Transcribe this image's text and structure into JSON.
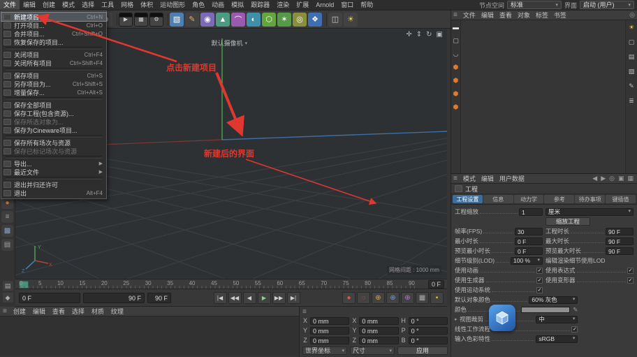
{
  "colors": {
    "accent_blue": "#3f6d99",
    "annotation_red": "#e0372e",
    "axis_x": "#a04438",
    "axis_y": "#4ea34e",
    "axis_z": "#4a7fc0"
  },
  "icons": {
    "hamburger": "≡",
    "caret": "▾",
    "search": "◎",
    "camera_caret": "▾",
    "eyedropper": "✎"
  },
  "menubar": {
    "items": [
      {
        "label": "文件",
        "active": true
      },
      {
        "label": "编辑"
      },
      {
        "label": "创建"
      },
      {
        "label": "模式"
      },
      {
        "label": "选择"
      },
      {
        "label": "工具"
      },
      {
        "label": "网格"
      },
      {
        "label": "体积"
      },
      {
        "label": "运动图形"
      },
      {
        "label": "角色"
      },
      {
        "label": "动画"
      },
      {
        "label": "模拟"
      },
      {
        "label": "跟踪器"
      },
      {
        "label": "渲染"
      },
      {
        "label": "扩展"
      },
      {
        "label": "Arnold"
      },
      {
        "label": "窗口"
      },
      {
        "label": "帮助"
      }
    ],
    "node_space_label": "节点空间",
    "node_space_value": "标准",
    "interface_label": "界面",
    "interface_value": "启动 (用户)"
  },
  "toolbar": {
    "icons": [
      {
        "name": "undo-icon",
        "glyph": "↶",
        "fg": "#e3bd66"
      },
      {
        "name": "redo-icon",
        "glyph": "↷",
        "fg": "#9f9f9f"
      },
      {
        "sep": true
      },
      {
        "name": "live-selection-icon",
        "glyph": "⇖",
        "fg": "#eeeeee"
      },
      {
        "sep": true
      },
      {
        "name": "lock-x-axis-icon",
        "glyph": "X",
        "circle": true
      },
      {
        "name": "lock-y-axis-icon",
        "glyph": "Y",
        "circle": true
      },
      {
        "name": "lock-z-axis-icon",
        "glyph": "Z",
        "circle": true
      },
      {
        "name": "coordinate-system-icon",
        "glyph": "⊕",
        "fg": "#cfcfcf"
      },
      {
        "sep": true
      },
      {
        "name": "render-view-icon",
        "glyph": "▶",
        "clap": true
      },
      {
        "name": "render-region-icon",
        "glyph": "▦",
        "clap": true
      },
      {
        "name": "render-settings-icon",
        "glyph": "⚙",
        "clap": true
      },
      {
        "sep": true
      },
      {
        "name": "cube-primitive-icon",
        "glyph": "▧",
        "fg": "#ffffff",
        "bg": "#4d7fb3"
      },
      {
        "name": "pen-spline-icon",
        "glyph": "✎",
        "fg": "#e8b25a"
      },
      {
        "name": "subdivision-surface-icon",
        "glyph": "◉",
        "fg": "#ffffff",
        "bg": "#7a6ab8"
      },
      {
        "name": "extrude-icon",
        "glyph": "▲",
        "fg": "#ffffff",
        "bg": "#4d9b82"
      },
      {
        "name": "bend-deformer-icon",
        "glyph": "⌒",
        "fg": "#ffffff",
        "bg": "#9a5ab0"
      },
      {
        "name": "field-icon",
        "glyph": "◐",
        "fg": "#ffffff",
        "bg": "#3f8fa8"
      },
      {
        "name": "cloner-icon",
        "glyph": "⬡",
        "fg": "#ffffff",
        "bg": "#63a53f"
      },
      {
        "name": "effector-icon",
        "glyph": "✶",
        "fg": "#ffffff",
        "bg": "#559a46"
      },
      {
        "name": "simulation-icon",
        "glyph": "◎",
        "fg": "#ffffff",
        "bg": "#8a8f3f"
      },
      {
        "name": "volume-icon",
        "glyph": "❖",
        "fg": "#ffffff",
        "bg": "#3f6fb0"
      },
      {
        "sep": true
      },
      {
        "name": "camera-icon",
        "glyph": "◫",
        "fg": "#cfcfcf"
      },
      {
        "name": "light-icon",
        "glyph": "☀",
        "fg": "#e8cf5a"
      }
    ]
  },
  "left_toolbar": {
    "icons": [
      {
        "name": "make-editable-icon",
        "glyph": "◇",
        "fg": "#cfcfcf"
      },
      {
        "name": "model-mode-icon",
        "glyph": "▣",
        "fg": "#cfcfcf"
      },
      {
        "name": "texture-mode-icon",
        "glyph": "▨",
        "fg": "#cfcfcf"
      },
      {
        "name": "workplane-mode-icon",
        "glyph": "▦",
        "fg": "#cfcfcf"
      },
      {
        "name": "point-mode-icon",
        "glyph": "∴",
        "fg": "#cfcfcf"
      },
      {
        "name": "edge-mode-icon",
        "glyph": "╱",
        "fg": "#cfcfcf"
      },
      {
        "name": "polygon-mode-icon",
        "glyph": "▲",
        "fg": "#cfcfcf"
      },
      {
        "name": "axis-mode-icon",
        "glyph": "✛",
        "fg": "#cfcfcf"
      },
      {
        "name": "solo-mode-icon",
        "glyph": "◎",
        "fg": "#cfcfcf"
      },
      {
        "name": "snap-icon",
        "glyph": "◈",
        "fg": "#cfcfcf"
      },
      {
        "gap": true
      },
      {
        "name": "content-browser-icon",
        "glyph": "●",
        "fg": "#e07a2e"
      },
      {
        "name": "script-icon",
        "glyph": "≡",
        "fg": "#9f9f9f"
      },
      {
        "name": "xpresso-icon",
        "glyph": "▩",
        "fg": "#7a9fd4"
      },
      {
        "name": "console-icon",
        "glyph": "▤",
        "fg": "#9f9f9f"
      }
    ]
  },
  "file_menu": {
    "items": [
      {
        "label": "新建项目",
        "shortcut": "Ctrl+N",
        "highlight": true
      },
      {
        "label": "打开项目...",
        "shortcut": "Ctrl+O"
      },
      {
        "label": "合并项目...",
        "shortcut": "Ctrl+Shift+O"
      },
      {
        "label": "恢复保存的项目..."
      },
      {
        "sep": true
      },
      {
        "label": "关闭项目",
        "shortcut": "Ctrl+F4"
      },
      {
        "label": "关闭所有项目",
        "shortcut": "Ctrl+Shift+F4"
      },
      {
        "sep": true
      },
      {
        "label": "保存项目",
        "shortcut": "Ctrl+S"
      },
      {
        "label": "另存项目为...",
        "shortcut": "Ctrl+Shift+S"
      },
      {
        "label": "增量保存...",
        "shortcut": "Ctrl+Alt+S"
      },
      {
        "sep": true
      },
      {
        "label": "保存全部项目"
      },
      {
        "label": "保存工程(包含资源)..."
      },
      {
        "label": "保存所选对象为...",
        "disabled": true
      },
      {
        "label": "保存为Cineware项目..."
      },
      {
        "sep": true
      },
      {
        "label": "保存所有场次与资源"
      },
      {
        "label": "保存已标记场次与资源",
        "disabled": true
      },
      {
        "sep": true
      },
      {
        "label": "导出...",
        "arrow": "▶"
      },
      {
        "label": "最近文件",
        "arrow": "▶"
      },
      {
        "sep": true
      },
      {
        "label": "退出并归还许可"
      },
      {
        "label": "退出",
        "shortcut": "Alt+F4"
      }
    ]
  },
  "viewport": {
    "camera_label": "默认摄像机",
    "grid_label": "网格间距 : 1000 mm",
    "axis_labels": {
      "x": "X",
      "y": "Y",
      "z": "Z"
    },
    "nav_icons": [
      {
        "name": "pan-view-icon",
        "glyph": "✛"
      },
      {
        "name": "zoom-view-icon",
        "glyph": "⇕"
      },
      {
        "name": "rotate-view-icon",
        "glyph": "↻"
      },
      {
        "name": "maximize-view-icon",
        "glyph": "▣"
      }
    ]
  },
  "annotations": {
    "click_text": "点击新建项目",
    "result_text": "新建后的界面"
  },
  "timeline": {
    "numbers": [
      "0",
      "5",
      "10",
      "15",
      "20",
      "25",
      "30",
      "35",
      "40",
      "45",
      "50",
      "55",
      "60",
      "65",
      "70",
      "75",
      "80",
      "85",
      "90"
    ],
    "end_label": "0 F"
  },
  "transport": {
    "current": "0 F",
    "range_end": "90 F",
    "range_end2": "90 F",
    "playback": [
      {
        "name": "goto-start-button",
        "glyph": "|◀"
      },
      {
        "name": "prev-key-button",
        "glyph": "◀◀"
      },
      {
        "name": "prev-frame-button",
        "glyph": "◀"
      },
      {
        "name": "play-button",
        "glyph": "▶",
        "play": true
      },
      {
        "name": "next-frame-button",
        "glyph": "▶▶"
      },
      {
        "name": "goto-end-button",
        "glyph": "▶|"
      }
    ],
    "record": [
      {
        "name": "record-keyframe-button",
        "glyph": "●",
        "fg": "#d8584a"
      },
      {
        "name": "autokey-button",
        "glyph": "◌",
        "fg": "#d8584a"
      },
      {
        "name": "record-position-button",
        "glyph": "⊕",
        "fg": "#e0a23c"
      },
      {
        "name": "record-scale-button",
        "glyph": "⊕",
        "fg": "#6b9bd2"
      },
      {
        "name": "record-rotation-button",
        "glyph": "⊕",
        "fg": "#b671d6"
      },
      {
        "name": "record-parameter-button",
        "glyph": "▦",
        "fg": "#a8a8a8"
      },
      {
        "name": "record-pla-button",
        "glyph": "▪",
        "fg": "#d9c24a"
      }
    ],
    "corner_icons": [
      {
        "name": "timeline-layout-icon",
        "glyph": "▤"
      },
      {
        "name": "keyframe-icon",
        "glyph": "◆"
      }
    ]
  },
  "material_panel": {
    "menus": [
      "创建",
      "编辑",
      "查看",
      "选择",
      "材质",
      "纹理"
    ]
  },
  "coord_panel": {
    "rows": [
      {
        "l1": "X",
        "v1": "0 mm",
        "l2": "X",
        "v2": "0 mm",
        "l3": "H",
        "v3": "0 °"
      },
      {
        "l1": "Y",
        "v1": "0 mm",
        "l2": "Y",
        "v2": "0 mm",
        "l3": "P",
        "v3": "0 °"
      },
      {
        "l1": "Z",
        "v1": "0 mm",
        "l2": "Z",
        "v2": "0 mm",
        "l3": "B",
        "v3": "0 °"
      }
    ],
    "mode_select": "世界坐标",
    "size_select": "尺寸",
    "apply_label": "应用"
  },
  "object_manager": {
    "menus": [
      "文件",
      "编辑",
      "查看",
      "对象",
      "标签",
      "书签"
    ],
    "left_strip": [
      {
        "name": "clapper-icon",
        "glyph": "▬",
        "fg": "#e8e8e8"
      },
      {
        "name": "screen-icon",
        "glyph": "▢",
        "fg": "#bdbdbd"
      },
      {
        "name": "magnet-icon",
        "glyph": "◡",
        "fg": "#bdbdbd"
      },
      {
        "name": "hex-bolt-icon-1",
        "glyph": "⬢",
        "fg": "#e07a2e"
      },
      {
        "name": "hex-bolt-icon-2",
        "glyph": "⬢",
        "fg": "#e07a2e"
      },
      {
        "name": "hex-bolt-icon-3",
        "glyph": "⬢",
        "fg": "#e07a2e"
      },
      {
        "name": "hex-bolt-icon-4",
        "glyph": "⬢",
        "fg": "#e07a2e"
      }
    ],
    "right_strip": [
      {
        "name": "light-bulb-icon",
        "glyph": "☀",
        "fg": "#e8cf5a"
      },
      {
        "name": "monitor-icon",
        "glyph": "▢",
        "fg": "#bdbdbd"
      },
      {
        "name": "film-icon",
        "glyph": "▤",
        "fg": "#bdbdbd"
      },
      {
        "name": "cube-icon",
        "glyph": "▧",
        "fg": "#bdbdbd"
      },
      {
        "name": "pen-icon",
        "glyph": "✎",
        "fg": "#bdbdbd"
      },
      {
        "name": "layers-icon",
        "glyph": "≣",
        "fg": "#bdbdbd"
      }
    ]
  },
  "attribute_manager": {
    "menus": [
      "模式",
      "编辑",
      "用户数据"
    ],
    "header_icons": [
      {
        "name": "history-back-icon",
        "glyph": "◀"
      },
      {
        "name": "history-forward-icon",
        "glyph": "▶"
      },
      {
        "name": "search-icon",
        "glyph": "◎"
      },
      {
        "name": "lock-icon",
        "glyph": "▣"
      },
      {
        "name": "grid-view-icon",
        "glyph": "▦"
      }
    ],
    "object_label": "工程",
    "tabs": [
      {
        "label": "工程设置",
        "active": true
      },
      {
        "label": "信息"
      },
      {
        "label": "动力学"
      },
      {
        "label": "参考"
      },
      {
        "label": "待办事项"
      },
      {
        "label": "键插值"
      }
    ],
    "fields": {
      "scale_label": "工程缩放",
      "scale_value": "1",
      "scale_unit": "厘米",
      "scale_button": "缩放工程",
      "fps_label": "帧率(FPS)",
      "fps_value": "30",
      "length_label": "工程时长",
      "length_value": "90 F",
      "min_label": "最小时长",
      "min_value": "0 F",
      "max_label": "最大时长",
      "max_value": "90 F",
      "pmin_label": "预览最小时长",
      "pmin_value": "0 F",
      "pmax_label": "预览最大时长",
      "pmax_value": "90 F",
      "lod_label": "细节级别(LOD)",
      "lod_value": "100 %",
      "lod_right_label": "编辑渲染细节使用LOD",
      "use_animation": "使用动画",
      "use_expressions": "使用表达式",
      "use_generators": "使用生成器",
      "use_deformers": "使用变形器",
      "use_motion": "使用运动系统",
      "default_color_label": "默认对象颜色",
      "default_color_value": "60% 灰色",
      "color_label": "颜色",
      "clip_label": "视图裁剪",
      "clip_value": "中",
      "lwf_label": "线性工作流程",
      "input_profile_label": "输入色彩特性",
      "input_profile_value": "sRGB"
    }
  }
}
